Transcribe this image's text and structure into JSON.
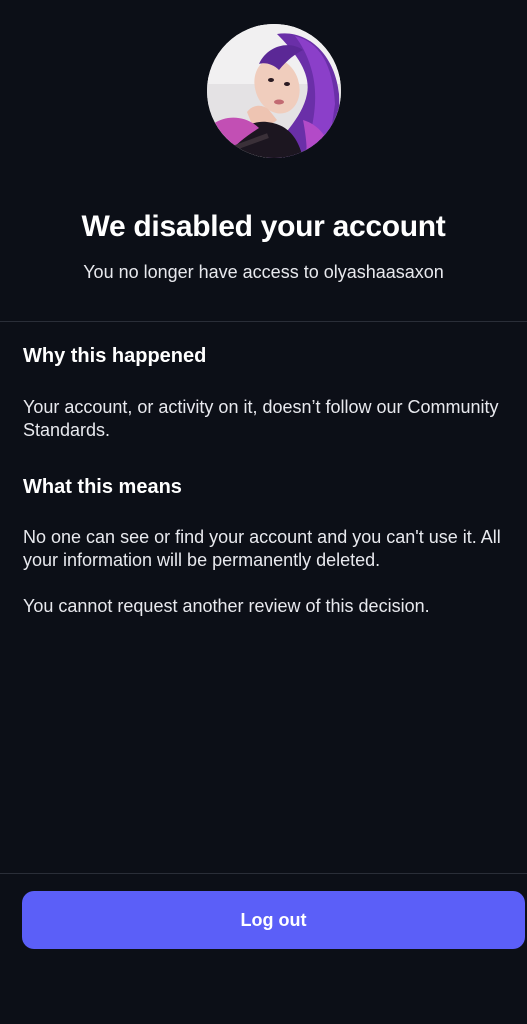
{
  "header": {
    "title": "We disabled your account",
    "subtitle": "You no longer have access to olyashaasaxon"
  },
  "why": {
    "title": "Why this happened",
    "body": "Your account, or activity on it, doesn’t follow our Community Standards."
  },
  "means": {
    "title": "What this means",
    "body": "No one can see or find your account and you can't use it. All your information will be permanently deleted.",
    "note": "You cannot request another review of this decision."
  },
  "actions": {
    "logout_label": "Log out"
  },
  "colors": {
    "background": "#0c0f17",
    "accent": "#5b5ff8",
    "divider": "#2a2e38"
  }
}
